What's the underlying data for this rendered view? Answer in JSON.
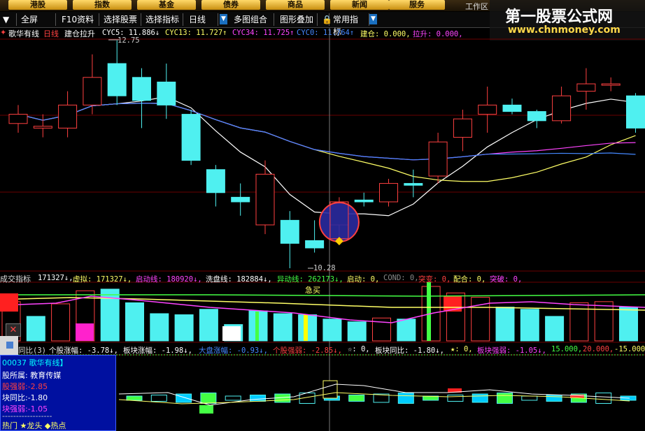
{
  "colors": {
    "up": "#ff4040",
    "down": "#4ff0f0",
    "grid": "#8b0000",
    "accent": "#1a6fbf"
  },
  "top_tabs": [
    "港股",
    "指数",
    "基金",
    "债券",
    "商品",
    "新闻",
    "服务"
  ],
  "top_right_partial": "工作区",
  "brand": {
    "title": "第一股票公式网",
    "url": "www.chnmoney.com"
  },
  "toolbar": {
    "fullscreen": "全屏",
    "f10": "F10资料",
    "select_stock": "选择股票",
    "select_indicator": "选择指标",
    "period": "日线",
    "multi_chart": "多图组合",
    "overlay": "图形叠加",
    "common_indicator": "常用指标"
  },
  "main_panel": {
    "name": "歌华有线",
    "period": "日线",
    "indicator": "建仓拉升",
    "cyc5": "CYC5: 11.886↓",
    "cyc13": "CYC13: 11.727↑",
    "cyc34": "CYC34: 11.725↑",
    "cyc0": "CYC0: 11.764↑",
    "jiancang": "建仓: 0.000,",
    "lasheng": "拉升: 0.000,",
    "high_label": "12.75",
    "low_label": "10.28"
  },
  "volume_panel": {
    "title": "成交指标",
    "vol": "171327↓,",
    "virtual": "虚拟: 171327↓,",
    "qidongxian": "启动线: 180920↓,",
    "xipanxian": "洗盘线: 182884↓,",
    "yidongxian": "异动线: 262173↓,",
    "qidong": "启动: 0,",
    "cond": "COND: 0,",
    "tubian": "突变: 0,",
    "peihe": "配合: 0,",
    "tupo": "突破: 0,",
    "jimai": "急买"
  },
  "sector_panel": {
    "title": "同比(3)",
    "stock_rise": "个股涨幅: -3.78↓,",
    "sector_rise": "板块涨幅: -1.98↓,",
    "market_rise": "大盘涨幅: -0.93↓,",
    "stock_strength": "个股强弱: -2.85↓,",
    "star": "☆: 0,",
    "sector_yoy": "板块同比: -1.80↓,",
    "star2": "★: 0,",
    "sector_strength": "板块强弱: -1.05↓,",
    "l15": "15.000,",
    "l20": "20.000,",
    "lm15": "-15.000"
  },
  "infobox": {
    "code_name": "00037 歌华有线】",
    "sector": "股所属: 教育传媒",
    "stock_strength": "股强弱:-2.85",
    "sector_yoy": "块同比:-1.80",
    "sector_strength": "块强弱:-1.05",
    "sep": "------------------",
    "legend": "热门 ★龙头 ◆热点"
  },
  "chart_data": {
    "type": "candlestick",
    "ylim": [
      10.28,
      12.75
    ],
    "candles": [
      {
        "o": 11.85,
        "c": 11.95,
        "h": 12.05,
        "l": 11.75
      },
      {
        "o": 11.8,
        "c": 11.82,
        "h": 11.95,
        "l": 11.7
      },
      {
        "o": 11.8,
        "c": 12.05,
        "h": 12.2,
        "l": 11.7
      },
      {
        "o": 12.05,
        "c": 12.35,
        "h": 12.6,
        "l": 11.95
      },
      {
        "o": 12.5,
        "c": 12.15,
        "h": 12.75,
        "l": 12.05
      },
      {
        "o": 12.35,
        "c": 12.1,
        "h": 12.45,
        "l": 11.8
      },
      {
        "o": 12.3,
        "c": 12.05,
        "h": 12.5,
        "l": 11.9
      },
      {
        "o": 11.95,
        "c": 11.45,
        "h": 12.0,
        "l": 11.4
      },
      {
        "o": 11.35,
        "c": 11.1,
        "h": 11.4,
        "l": 10.95
      },
      {
        "o": 11.05,
        "c": 11.0,
        "h": 11.2,
        "l": 10.85
      },
      {
        "o": 10.75,
        "c": 11.3,
        "h": 11.45,
        "l": 10.65
      },
      {
        "o": 10.8,
        "c": 10.55,
        "h": 10.9,
        "l": 10.28
      },
      {
        "o": 10.58,
        "c": 10.5,
        "h": 10.8,
        "l": 10.45
      },
      {
        "o": 10.75,
        "c": 11.0,
        "h": 11.05,
        "l": 10.6
      },
      {
        "o": 11.02,
        "c": 11.0,
        "h": 11.1,
        "l": 10.95
      },
      {
        "o": 11.0,
        "c": 11.2,
        "h": 11.25,
        "l": 10.95
      },
      {
        "o": 11.2,
        "c": 11.18,
        "h": 11.35,
        "l": 11.05
      },
      {
        "o": 11.28,
        "c": 11.65,
        "h": 11.75,
        "l": 11.2
      },
      {
        "o": 11.7,
        "c": 11.9,
        "h": 12.0,
        "l": 11.55
      },
      {
        "o": 11.95,
        "c": 12.05,
        "h": 12.25,
        "l": 11.75
      },
      {
        "o": 12.05,
        "c": 11.98,
        "h": 12.12,
        "l": 11.95
      },
      {
        "o": 11.98,
        "c": 11.88,
        "h": 12.0,
        "l": 11.8
      },
      {
        "o": 11.88,
        "c": 12.15,
        "h": 12.25,
        "l": 11.85
      },
      {
        "o": 12.2,
        "c": 12.28,
        "h": 12.45,
        "l": 12.0
      },
      {
        "o": 12.28,
        "c": 12.28,
        "h": 12.35,
        "l": 12.2
      },
      {
        "o": 12.15,
        "c": 11.8,
        "h": 12.18,
        "l": 11.75
      }
    ],
    "volume": [
      {
        "v": 0.72,
        "up": true
      },
      {
        "v": 0.45,
        "up": false
      },
      {
        "v": 0.68,
        "up": true
      },
      {
        "v": 0.92,
        "up": true
      },
      {
        "v": 0.95,
        "up": false
      },
      {
        "v": 0.7,
        "up": false
      },
      {
        "v": 0.5,
        "up": false
      },
      {
        "v": 0.48,
        "up": false
      },
      {
        "v": 0.58,
        "up": false
      },
      {
        "v": 0.3,
        "up": false
      },
      {
        "v": 0.55,
        "up": false
      },
      {
        "v": 0.5,
        "up": false
      },
      {
        "v": 0.48,
        "up": false
      },
      {
        "v": 0.4,
        "up": false
      },
      {
        "v": 0.35,
        "up": false
      },
      {
        "v": 0.42,
        "up": true
      },
      {
        "v": 0.4,
        "up": false
      },
      {
        "v": 1.0,
        "up": true
      },
      {
        "v": 0.88,
        "up": true
      },
      {
        "v": 0.8,
        "up": true
      },
      {
        "v": 0.62,
        "up": false
      },
      {
        "v": 0.58,
        "up": false
      },
      {
        "v": 0.45,
        "up": false
      },
      {
        "v": 0.7,
        "up": true
      },
      {
        "v": 0.72,
        "up": true
      },
      {
        "v": 0.62,
        "up": false
      }
    ]
  }
}
